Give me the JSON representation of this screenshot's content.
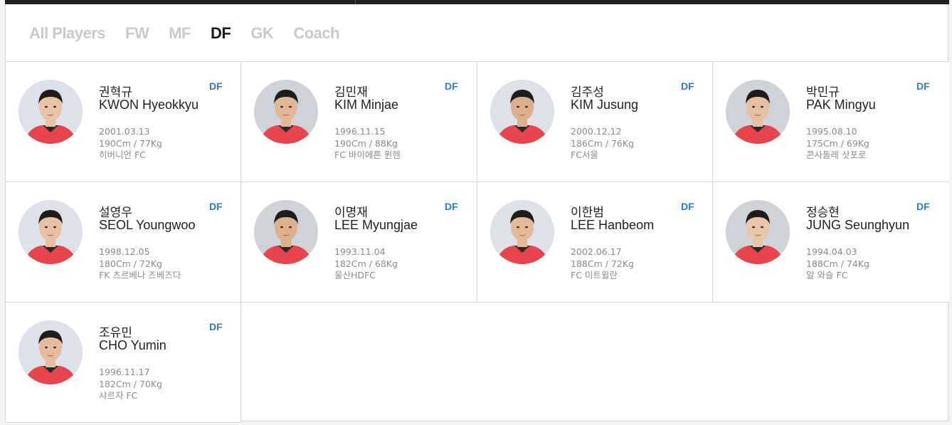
{
  "tabs": [
    {
      "label": "All Players",
      "active": false
    },
    {
      "label": "FW",
      "active": false
    },
    {
      "label": "MF",
      "active": false
    },
    {
      "label": "DF",
      "active": true
    },
    {
      "label": "GK",
      "active": false
    },
    {
      "label": "Coach",
      "active": false
    }
  ],
  "colors": {
    "accent": "#2d7bd1",
    "tab_inactive": "#c9c9c9",
    "tab_active": "#1a1a1a",
    "jersey": "#e8444e",
    "topbar": "#231f20"
  },
  "players": [
    {
      "korean_name": "권혁규",
      "english_name": "KWON Hyeokkyu",
      "position": "DF",
      "birth": "2001.03.13",
      "body": "190Cm / 77Kg",
      "club": "히버니언 FC"
    },
    {
      "korean_name": "김민재",
      "english_name": "KIM Minjae",
      "position": "DF",
      "birth": "1996.11.15",
      "body": "190Cm / 88Kg",
      "club": "FC 바이에른 뮌헨"
    },
    {
      "korean_name": "김주성",
      "english_name": "KIM Jusung",
      "position": "DF",
      "birth": "2000.12.12",
      "body": "186Cm / 76Kg",
      "club": "FC서울"
    },
    {
      "korean_name": "박민규",
      "english_name": "PAK Mingyu",
      "position": "DF",
      "birth": "1995.08.10",
      "body": "175Cm / 69Kg",
      "club": "콘사돌레 삿포로"
    },
    {
      "korean_name": "설영우",
      "english_name": "SEOL Youngwoo",
      "position": "DF",
      "birth": "1998.12.05",
      "body": "180Cm / 72Kg",
      "club": "FK 츠르베나 즈베즈다"
    },
    {
      "korean_name": "이명재",
      "english_name": "LEE Myungjae",
      "position": "DF",
      "birth": "1993.11.04",
      "body": "182Cm / 68Kg",
      "club": "울산HDFC"
    },
    {
      "korean_name": "이한범",
      "english_name": "LEE Hanbeom",
      "position": "DF",
      "birth": "2002.06.17",
      "body": "188Cm / 72Kg",
      "club": "FC 미트윌란"
    },
    {
      "korean_name": "정승현",
      "english_name": "JUNG Seunghyun",
      "position": "DF",
      "birth": "1994.04.03",
      "body": "188Cm / 74Kg",
      "club": "알 와슬 FC"
    },
    {
      "korean_name": "조유민",
      "english_name": "CHO Yumin",
      "position": "DF",
      "birth": "1996.11.17",
      "body": "182Cm / 70Kg",
      "club": "샤르자 FC"
    }
  ]
}
